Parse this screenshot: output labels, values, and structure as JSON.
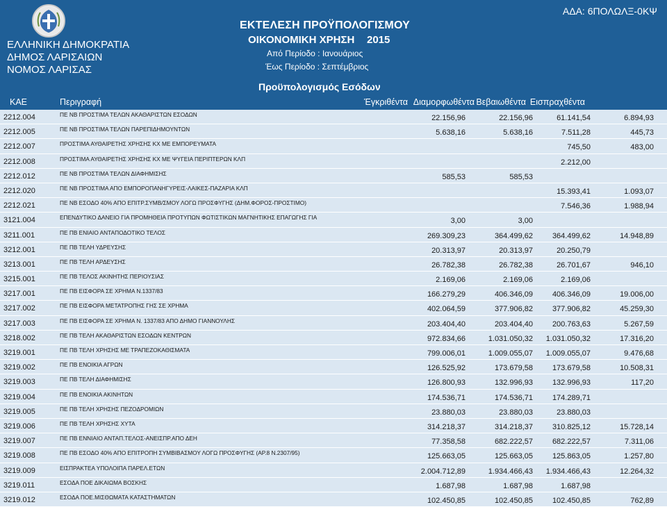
{
  "header": {
    "left_lines": [
      "ΕΛΛΗΝΙΚΗ ΔΗΜΟΚΡΑΤΙΑ",
      "ΔΗΜΟΣ ΛΑΡΙΣΑΙΩΝ",
      "ΝΟΜΟΣ ΛΑΡΙΣΑΣ"
    ],
    "title": "ΕΚΤΕΛΕΣΗ ΠΡΟΫΠΟΛΟΓΙΣΜΟΥ",
    "fiscal_year_label": "ΟΙΚΟΝΟΜΙΚΗ ΧΡΗΣΗ",
    "year": "2015",
    "period_from": "Από Περίοδο :  Ιανουάριος",
    "period_to": "Έως Περίοδο :  Σεπτέμβριος",
    "ada": "ΑΔΑ: 6ΠΟΛΩΛΞ-0ΚΨ",
    "subtitle": "Προϋπολογισμός Εσόδων"
  },
  "columns": {
    "kae": "ΚΑΕ",
    "description": "Περιγραφή",
    "approved": "Έγκριθέντα",
    "assessed": "Διαμορφωθέντα",
    "certified": "Βεβαιωθέντα",
    "collected": "Εισπραχθέντα"
  },
  "colors": {
    "header_bg": "#1f5f97",
    "row_bg": "#dbe7f2",
    "text": "#1a1a1a"
  },
  "rows": [
    {
      "kae": "2212.004",
      "desc": "ΠΕ ΝΒ ΠΡΟΣΤΙΜΑ ΤΕΛΩΝ ΑΚΑΘΑΡΙΣΤΩΝ ΕΣΟΔΩΝ",
      "approved": "22.156,96",
      "assessed": "22.156,96",
      "certified": "61.141,54",
      "collected": "6.894,93"
    },
    {
      "kae": "2212.005",
      "desc": "ΠΕ ΝΒ ΠΡΟΣΤΙΜΑ ΤΕΛΩΝ ΠΑΡΕΠΙΔΗΜΟΥΝΤΩΝ",
      "approved": "5.638,16",
      "assessed": "5.638,16",
      "certified": "7.511,28",
      "collected": "445,73"
    },
    {
      "kae": "2212.007",
      "desc": "ΠΡΟΣΤΙΜΑ  ΑΥΘΑΙΡΕΤΗΣ  ΧΡΗΣΗΣ  ΚΧ ΜΕ ΕΜΠΟΡΕΥΜΑΤΑ",
      "approved": "",
      "assessed": "",
      "certified": "745,50",
      "collected": "483,00"
    },
    {
      "kae": "2212.008",
      "desc": "ΠΡΟΣΤΙΜΑ ΑΥΘΑΙΡΕΤΗΣ  ΧΡΗΣΗΣ  ΚΧ ΜΕ ΨΥΓΕΙΑ ΠΕΡΙΠΤΕΡΩΝ ΚΛΠ",
      "approved": "",
      "assessed": "",
      "certified": "2.212,00",
      "collected": ""
    },
    {
      "kae": "2212.012",
      "desc": "ΠΕ ΝΒ ΠΡΟΣΤΙΜΑ ΤΕΛΩΝ ΔΙΑΦΗΜΙΣΗΣ",
      "approved": "585,53",
      "assessed": "585,53",
      "certified": "",
      "collected": ""
    },
    {
      "kae": "2212.020",
      "desc": "ΠΕ ΝΒ ΠΡΟΣΤΙΜΑ ΑΠΟ ΕΜΠΟΡΟΠΑΝΗΓΥΡΕΙΣ-ΛΑΙΚΕΣ-ΠΑΖΑΡΙΑ ΚΛΠ",
      "approved": "",
      "assessed": "",
      "certified": "15.393,41",
      "collected": "1.093,07"
    },
    {
      "kae": "2212.021",
      "desc": "ΠΕ ΝΒ ΕΣΟΔΟ 40% ΑΠΟ ΕΠΙΤΡ.ΣΥΜΒ/ΣΜΟΥ ΛΟΓΩ ΠΡΟΣΦΥΓΗΣ (ΔΗΜ.ΦΟΡΟΣ-ΠΡΟΣΤΙΜΟ)",
      "approved": "",
      "assessed": "",
      "certified": "7.546,36",
      "collected": "1.988,94"
    },
    {
      "kae": "3121.004",
      "desc": "ΕΠΕΝΔΥΤΙΚΟ ΔΑΝΕΙΟ ΓΙΑ ΠΡΟΜΗΘΕΙΑ ΠΡΟΤΥΠΩΝ ΦΩΤΙΣΤΙΚΩΝ ΜΑΓΝΗΤΙΚΗΣ ΕΠΑΓΩΓΗΣ ΓΙΑ",
      "approved": "3,00",
      "assessed": "3,00",
      "certified": "",
      "collected": ""
    },
    {
      "kae": "3211.001",
      "desc": "ΠΕ ΠΒ ΕΝΙΑΙΟ ΑΝΤΑΠΟΔΟΤΙΚΟ ΤΕΛΟΣ",
      "approved": "269.309,23",
      "assessed": "364.499,62",
      "certified": "364.499,62",
      "collected": "14.948,89"
    },
    {
      "kae": "3212.001",
      "desc": "ΠΕ ΠΒ ΤΕΛΗ ΥΔΡΕΥΣΗΣ",
      "approved": "20.313,97",
      "assessed": "20.313,97",
      "certified": "20.250,79",
      "collected": ""
    },
    {
      "kae": "3213.001",
      "desc": "ΠΕ ΠΒ ΤΕΛΗ ΑΡΔΕΥΣΗΣ",
      "approved": "26.782,38",
      "assessed": "26.782,38",
      "certified": "26.701,67",
      "collected": "946,10"
    },
    {
      "kae": "3215.001",
      "desc": "ΠΕ ΠΒ ΤΕΛΟΣ ΑΚΙΝΗΤΗΣ ΠΕΡΙΟΥΣΙΑΣ",
      "approved": "2.169,06",
      "assessed": "2.169,06",
      "certified": "2.169,06",
      "collected": ""
    },
    {
      "kae": "3217.001",
      "desc": "ΠΕ ΠΒ ΕΙΣΦΟΡΑ ΣΕ ΧΡΗΜΑ Ν.1337/83",
      "approved": "166.279,29",
      "assessed": "406.346,09",
      "certified": "406.346,09",
      "collected": "19.006,00"
    },
    {
      "kae": "3217.002",
      "desc": "ΠΕ ΠΒ ΕΙΣΦΟΡΑ ΜΕΤΑΤΡΟΠΗΣ ΓΗΣ ΣΕ ΧΡΗΜΑ",
      "approved": "402.064,59",
      "assessed": "377.906,82",
      "certified": "377.906,82",
      "collected": "45.259,30"
    },
    {
      "kae": "3217.003",
      "desc": "ΠΕ ΠΒ ΕΙΣΦΟΡΑ ΣΕ ΧΡΗΜΑ Ν. 1337/83 ΑΠΟ ΔΗΜΟ ΓΙΑΝΝΟΥΛΗΣ",
      "approved": "203.404,40",
      "assessed": "203.404,40",
      "certified": "200.763,63",
      "collected": "5.267,59"
    },
    {
      "kae": "3218.002",
      "desc": "ΠΕ ΠΒ ΤΕΛΗ ΑΚΑΘΑΡΙΣΤΩΝ ΕΣΟΔΩΝ ΚΕΝΤΡΩΝ",
      "approved": "972.834,66",
      "assessed": "1.031.050,32",
      "certified": "1.031.050,32",
      "collected": "17.316,20"
    },
    {
      "kae": "3219.001",
      "desc": "ΠΕ ΠΒ ΤΕΛΗ ΧΡΗΣΗΣ ΜΕ ΤΡΑΠΕΖΟΚΑΘΙΣΜΑΤΑ",
      "approved": "799.006,01",
      "assessed": "1.009.055,07",
      "certified": "1.009.055,07",
      "collected": "9.476,68"
    },
    {
      "kae": "3219.002",
      "desc": "ΠΕ ΠΒ ΕΝΟΙΚΙΑ ΑΓΡΩΝ",
      "approved": "126.525,92",
      "assessed": "173.679,58",
      "certified": "173.679,58",
      "collected": "10.508,31"
    },
    {
      "kae": "3219.003",
      "desc": "ΠΕ ΠΒ ΤΕΛΗ ΔΙΑΦΗΜΙΣΗΣ",
      "approved": "126.800,93",
      "assessed": "132.996,93",
      "certified": "132.996,93",
      "collected": "117,20"
    },
    {
      "kae": "3219.004",
      "desc": "ΠΕ ΠΒ ΕΝΟΙΚΙΑ ΑΚΙΝΗΤΩΝ",
      "approved": "174.536,71",
      "assessed": "174.536,71",
      "certified": "174.289,71",
      "collected": ""
    },
    {
      "kae": "3219.005",
      "desc": "ΠΕ ΠΒ ΤΕΛΗ ΧΡΗΣΗΣ ΠΕΖΟΔΡΟΜΙΩΝ",
      "approved": "23.880,03",
      "assessed": "23.880,03",
      "certified": "23.880,03",
      "collected": ""
    },
    {
      "kae": "3219.006",
      "desc": "ΠΕ ΠΒ ΤΕΛΗ ΧΡΗΣΗΣ ΧΥΤΑ",
      "approved": "314.218,37",
      "assessed": "314.218,37",
      "certified": "310.825,12",
      "collected": "15.728,14"
    },
    {
      "kae": "3219.007",
      "desc": "ΠΕ ΠΒ ΕΝΝΙΑΙΟ ΑΝΤΑΠ.ΤΕΛΟΣ-ΑΝΕΙΣΠΡ.ΑΠΟ ΔΕΗ",
      "approved": "77.358,58",
      "assessed": "682.222,57",
      "certified": "682.222,57",
      "collected": "7.311,06"
    },
    {
      "kae": "3219.008",
      "desc": "ΠΕ ΠΒ ΕΣΟΔΟ 40% ΑΠΟ ΕΠΙΤΡΟΠΗ ΣΥΜΒΙΒΑΣΜΟΥ ΛΟΓΩ ΠΡΟΣΦΥΓΗΣ (ΑΡ.8 Ν.2307/95)",
      "approved": "125.663,05",
      "assessed": "125.663,05",
      "certified": "125.863,05",
      "collected": "1.257,80"
    },
    {
      "kae": "3219.009",
      "desc": "ΕΙΣΠΡΑΚΤΕΑ ΥΠΟΛΟΙΠΑ ΠΑΡΕΛ.ΕΤΩΝ",
      "approved": "2.004.712,89",
      "assessed": "1.934.466,43",
      "certified": "1.934.466,43",
      "collected": "12.264,32"
    },
    {
      "kae": "3219.011",
      "desc": "ΕΣΟΔΑ  ΠΟΕ  ΔΙΚΑΙΩΜΑ  ΒΟΣΚΗΣ",
      "approved": "1.687,98",
      "assessed": "1.687,98",
      "certified": "1.687,98",
      "collected": ""
    },
    {
      "kae": "3219.012",
      "desc": "ΕΣΟΔΑ  ΠΟΕ.ΜΙΣΘΩΜΑΤΑ  ΚΑΤΑΣΤΗΜΑΤΩΝ",
      "approved": "102.450,85",
      "assessed": "102.450,85",
      "certified": "102.450,85",
      "collected": "762,89"
    }
  ]
}
